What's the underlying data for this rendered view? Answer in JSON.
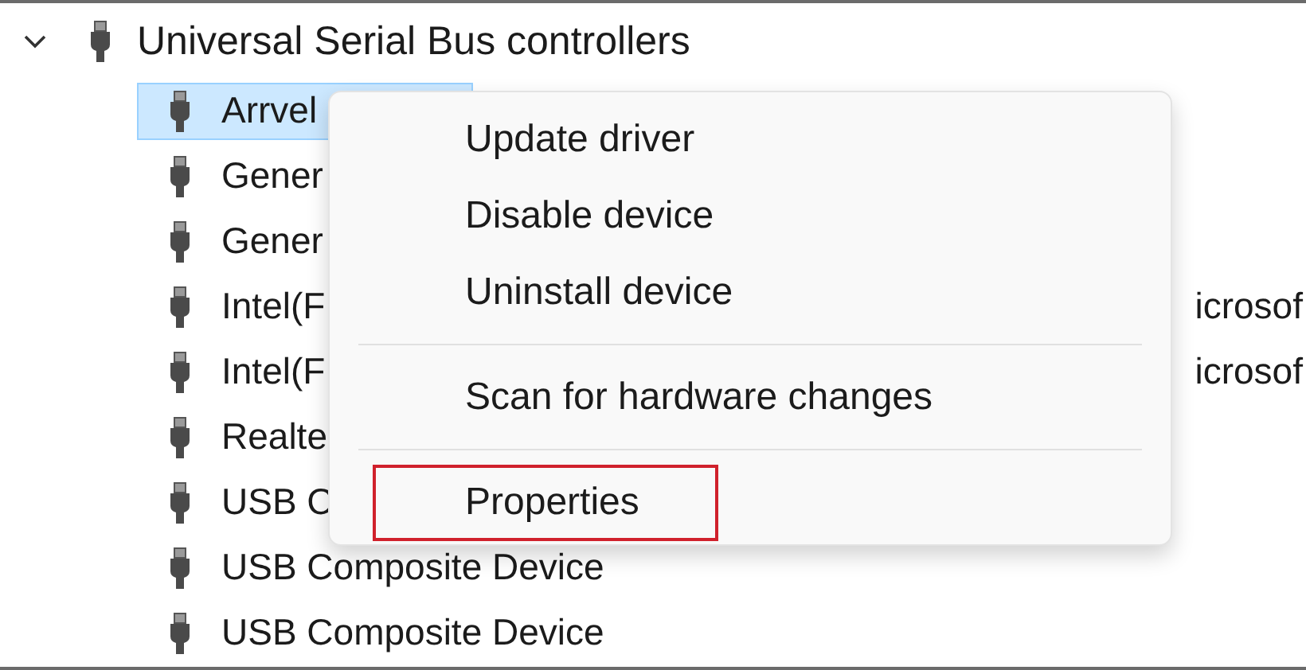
{
  "tree": {
    "category": {
      "label": "Universal Serial Bus controllers",
      "expanded": true,
      "children": [
        {
          "label": "Arrvel",
          "selected": true
        },
        {
          "label": "Gener",
          "selected": false
        },
        {
          "label": "Gener",
          "selected": false
        },
        {
          "label": "Intel(F",
          "selected": false,
          "trailing": "icrosof"
        },
        {
          "label": "Intel(F",
          "selected": false,
          "trailing": "icrosof"
        },
        {
          "label": "Realte",
          "selected": false
        },
        {
          "label": "USB C",
          "selected": false
        },
        {
          "label": "USB Composite Device",
          "selected": false
        },
        {
          "label": "USB Composite Device",
          "selected": false
        }
      ]
    }
  },
  "context_menu": {
    "items": [
      {
        "kind": "item",
        "label": "Update driver",
        "highlighted": false
      },
      {
        "kind": "item",
        "label": "Disable device",
        "highlighted": false
      },
      {
        "kind": "item",
        "label": "Uninstall device",
        "highlighted": false
      },
      {
        "kind": "separator"
      },
      {
        "kind": "item",
        "label": "Scan for hardware changes",
        "highlighted": false
      },
      {
        "kind": "separator"
      },
      {
        "kind": "item",
        "label": "Properties",
        "highlighted": true
      }
    ]
  }
}
